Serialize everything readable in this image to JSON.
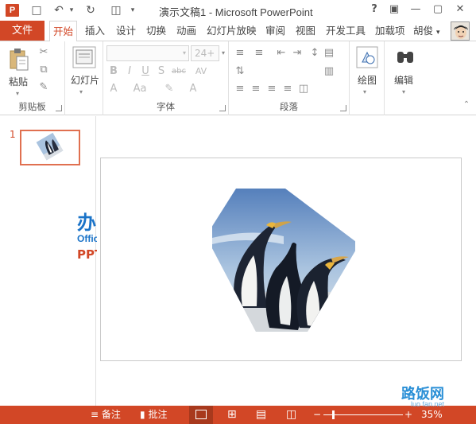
{
  "titlebar": {
    "app_glyph": "P",
    "title": "演示文稿1 - Microsoft PowerPoint",
    "help": "?",
    "minimize": "—",
    "restore": "▢",
    "close": "✕"
  },
  "tabs": {
    "file": "文件",
    "items": [
      "开始",
      "插入",
      "设计",
      "切换",
      "动画",
      "幻灯片放映",
      "审阅",
      "视图",
      "开发工具",
      "加载项"
    ],
    "active": "开始",
    "user": "胡俊"
  },
  "ribbon": {
    "clipboard": {
      "paste": "粘贴",
      "label": "剪贴板"
    },
    "slides": {
      "new_slide": "幻灯片",
      "label": ""
    },
    "font": {
      "font_size": "24+",
      "label": "字体"
    },
    "paragraph": {
      "label": "段落"
    },
    "drawing": {
      "label": "绘图"
    },
    "editing": {
      "label": "编辑"
    }
  },
  "thumbnails": {
    "slide_number": "1"
  },
  "watermark": {
    "cn": "办公族",
    "en": "Officezu.com",
    "ppt": "PPT教程"
  },
  "statusbar": {
    "notes": "备注",
    "comments": "批注",
    "zoom": "35%",
    "zoom_plus": "+",
    "zoom_minus": "−"
  },
  "corner_mark": {
    "text": "路饭网",
    "sub": "luo fan.net"
  },
  "colors": {
    "accent": "#d24726",
    "blue": "#1a73c8"
  }
}
